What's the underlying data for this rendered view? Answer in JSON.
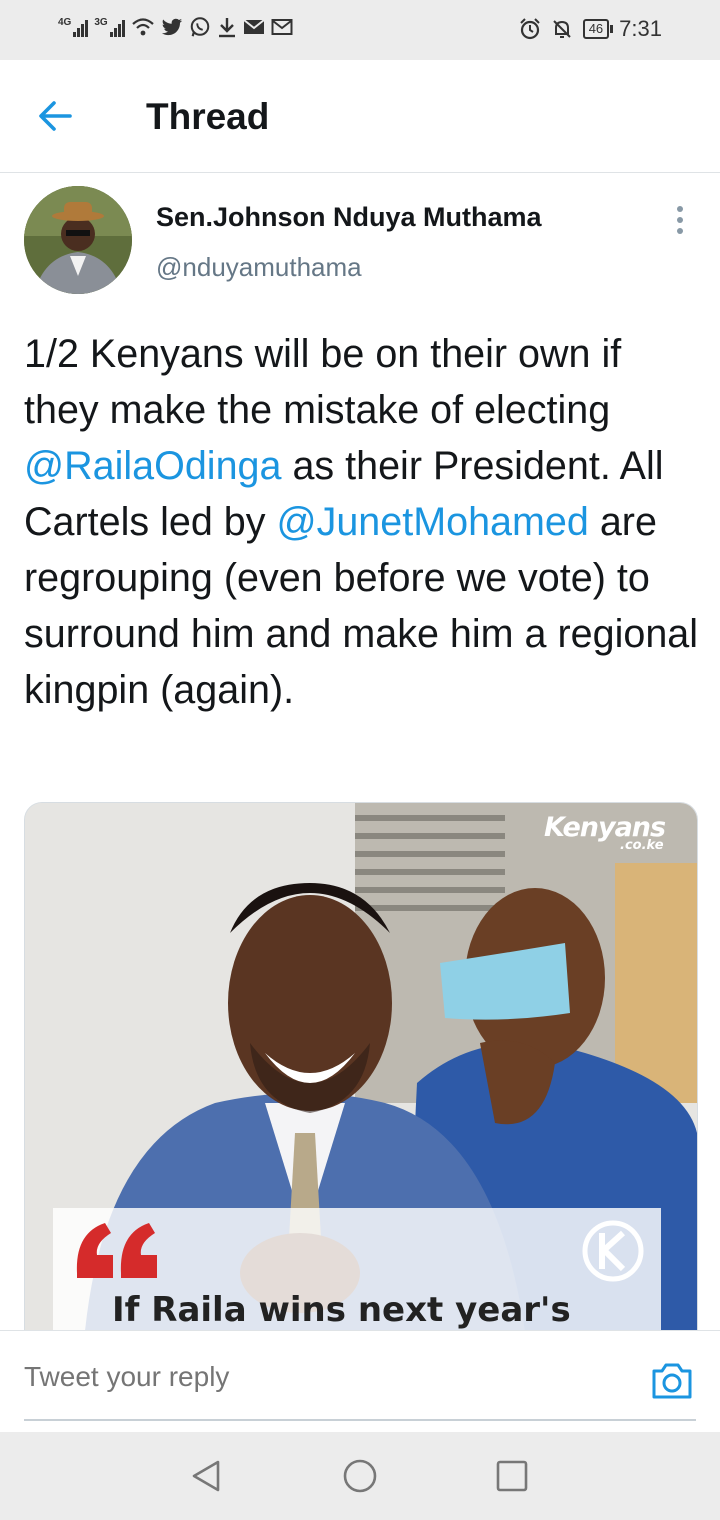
{
  "status_bar": {
    "signal1_label": "4G",
    "signal2_label": "3G",
    "battery": "46",
    "time": "7:31",
    "icons": [
      "wifi-icon",
      "twitter-icon",
      "whatsapp-icon",
      "download-icon",
      "email-icon",
      "gmail-icon",
      "alarm-icon",
      "mute-icon"
    ]
  },
  "header": {
    "title": "Thread",
    "back_icon": "back-arrow-icon"
  },
  "tweet": {
    "author_name": "Sen.Johnson Nduya Muthama",
    "author_handle": "@nduyamuthama",
    "text_1": "1/2 Kenyans will be on their own  if they make the mistake of electing ",
    "mention_1": "@RailaOdinga",
    "text_2": " as their President. All Cartels led by ",
    "mention_2": "@JunetMohamed",
    "text_3": " are regrouping (even before we vote) to surround him and make him a regional kingpin (again).",
    "media": {
      "logo": "Kenyans",
      "logo_sub": ".co.ke",
      "quote_text": "If Raila wins next year's"
    }
  },
  "reply": {
    "placeholder": "Tweet your reply"
  },
  "colors": {
    "accent": "#1b95e0",
    "text": "#14171a",
    "secondary": "#657786"
  }
}
